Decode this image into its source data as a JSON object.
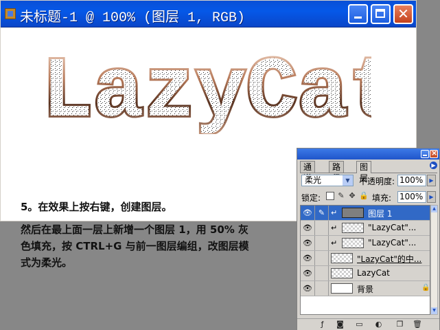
{
  "document": {
    "title": "未标题-1 @ 100% (图层 1, RGB)",
    "artwork_text": "LazyCat",
    "buttons": {
      "minimize": "minimize",
      "maximize": "maximize",
      "close": "close"
    }
  },
  "tutorial": {
    "step": "5。在效果上按右键，创建图层。",
    "lines": [
      "然后在最上面一层上新增一个图层 1，用 50% 灰",
      "色填充，按 CTRL+G 与前一图层编组，改图层模",
      "式为柔光。"
    ]
  },
  "layers_panel": {
    "tabs": [
      "通道",
      "路径",
      "图层"
    ],
    "active_tab": "图层",
    "blend_mode": "柔光",
    "opacity_label": "不透明度:",
    "opacity_value": "100%",
    "lock_label": "锁定:",
    "fill_label": "填充:",
    "fill_value": "100%",
    "layers": [
      {
        "name": "图层 1",
        "thumb": "gray",
        "selected": true,
        "clipped": true
      },
      {
        "name": "\"LazyCat\"...",
        "thumb": "transparent",
        "selected": false,
        "clipped": true
      },
      {
        "name": "\"LazyCat\"...",
        "thumb": "transparent",
        "selected": false,
        "clipped": true
      },
      {
        "name": "\"LazyCat\"的中...",
        "thumb": "transparent",
        "selected": false,
        "clipped": false
      },
      {
        "name": "LazyCat",
        "thumb": "transparent",
        "selected": false,
        "clipped": false
      },
      {
        "name": "背景",
        "thumb": "white",
        "selected": false,
        "clipped": false,
        "locked": true
      }
    ],
    "bottom_icons": [
      "layer-style-icon",
      "mask-icon",
      "folder-icon",
      "adjustment-icon",
      "new-layer-icon",
      "trash-icon"
    ]
  },
  "colors": {
    "titlebar": "#0558e8",
    "desktop": "#878787",
    "selection": "#3169c6",
    "chrome_text": "#c8926a"
  }
}
